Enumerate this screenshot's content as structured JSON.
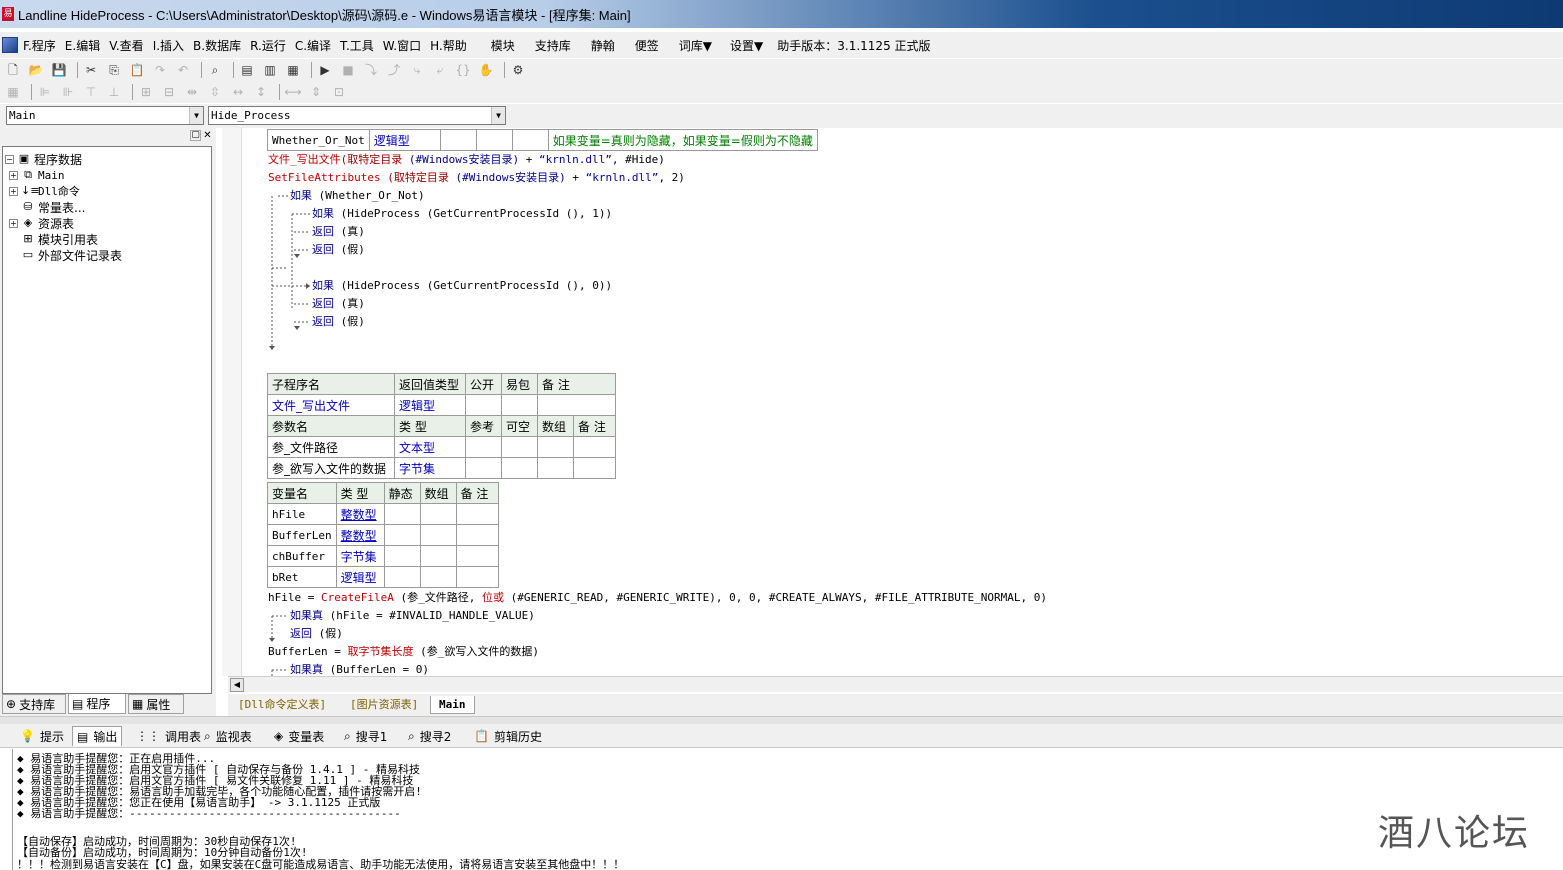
{
  "window": {
    "title": "Landline HideProcess - C:\\Users\\Administrator\\Desktop\\源码\\源码.e - Windows易语言模块 - [程序集: Main]"
  },
  "menu": {
    "items": [
      "F.程序",
      "E.编辑",
      "V.查看",
      "I.插入",
      "B.数据库",
      "R.运行",
      "C.编译",
      "T.工具",
      "W.窗口",
      "H.帮助",
      "模块",
      "支持库",
      "静翰",
      "便签",
      "词库▼",
      "设置▼",
      "助手版本：3.1.1125 正式版"
    ]
  },
  "combos": {
    "left": "Main",
    "right": "Hide_Process"
  },
  "tree": {
    "root": "程序数据",
    "items": [
      "Main",
      "Dll命令",
      "常量表...",
      "资源表",
      "模块引用表",
      "外部文件记录表"
    ]
  },
  "panel_tabs": [
    "支持库",
    "程序",
    "属性"
  ],
  "code": {
    "row_var": {
      "name": "Whether_Or_Not",
      "type": "逻辑型",
      "comment": "如果变量=真则为隐藏，如果变量=假则为不隐藏"
    },
    "l1_fn": "文件_写出文件",
    "l1_a": "(取特定目录",
    "l1_b": " (#Windows安装目录)",
    "l1_c": " + ",
    "l1_d": "“krnln.dll”",
    "l1_e": ", #Hide)",
    "l2_fn": "SetFileAttributes",
    "l2_a": " (取特定目录",
    "l2_b": " (#Windows安装目录)",
    "l2_c": " + ",
    "l2_d": "“krnln.dll”",
    "l2_e": ", 2)",
    "if1": "如果",
    "if1_cond": " (Whether_Or_Not)",
    "if2": "如果",
    "if2_cond": " (HideProcess (GetCurrentProcessId (), 1))",
    "ret_true": "返回",
    "ret_true_v": " (真)",
    "ret_false": "返回",
    "ret_false_v": " (假)",
    "if3": "如果",
    "if3_cond": " (HideProcess (GetCurrentProcessId (), 0))",
    "ret_true2": "返回",
    "ret_true2_v": " (真)",
    "ret_false2": "返回",
    "ret_false2_v": " (假)",
    "sub_header": [
      "子程序名",
      "返回值类型",
      "公开",
      "易包",
      "备 注"
    ],
    "sub_row": [
      "文件_写出文件",
      "逻辑型",
      "",
      "",
      ""
    ],
    "param_header": [
      "参数名",
      "类 型",
      "参考",
      "可空",
      "数组",
      "备 注"
    ],
    "params": [
      [
        "参_文件路径",
        "文本型",
        "",
        "",
        "",
        ""
      ],
      [
        "参_欲写入文件的数据",
        "字节集",
        "",
        "",
        "",
        ""
      ]
    ],
    "var_header": [
      "变量名",
      "类 型",
      "静态",
      "数组",
      "备 注"
    ],
    "vars": [
      [
        "hFile",
        "整数型",
        "",
        "",
        ""
      ],
      [
        "BufferLen",
        "整数型",
        "",
        "",
        ""
      ],
      [
        "chBuffer",
        "字节集",
        "",
        "",
        ""
      ],
      [
        "bRet",
        "逻辑型",
        "",
        "",
        ""
      ]
    ],
    "l3_a": "hFile = ",
    "l3_fn": "CreateFileA",
    "l3_b": " (参_文件路径, ",
    "l3_c": "位或",
    "l3_d": " (#GENERIC_READ, #GENERIC_WRITE), 0, 0, #CREATE_ALWAYS, #FILE_ATTRIBUTE_NORMAL, 0)",
    "l4_kw": "如果真",
    "l4_cond": " (hFile = #INVALID_HANDLE_VALUE)",
    "l5_kw": "返回",
    "l5_v": " (假)",
    "l6_a": "BufferLen = ",
    "l6_fn": "取字节集长度",
    "l6_b": " (参_欲写入文件的数据)",
    "l7_kw": "如果真",
    "l7_cond": " (BufferLen = 0)"
  },
  "doc_tabs": [
    "[Dll命令定义表]",
    "[图片资源表]",
    "Main"
  ],
  "out_tabs": [
    "提示",
    "输出",
    "调用表",
    "监视表",
    "变量表",
    "搜寻1",
    "搜寻2",
    "剪辑历史"
  ],
  "output_lines": [
    "◆ 易语言助手提醒您：正在启用插件...",
    "◆ 易语言助手提醒您：启用文官方插件 [ 自动保存与备份 1.4.1 ] - 精易科技",
    "◆ 易语言助手提醒您：启用文官方插件 [ 易文件关联修复 1.11 ] - 精易科技",
    "◆ 易语言助手提醒您：易语言助手加载完毕，各个功能随心配置，插件请按需开启!",
    "◆ 易语言助手提醒您：您正在使用【易语言助手】 -> 3.1.1125 正式版",
    "◆ 易语言助手提醒您：-----------------------------------------",
    "",
    "【自动保存】启动成功，时间周期为：30秒自动保存1次!",
    "【自动备份】启动成功，时间周期为：10分钟自动备份1次!",
    "！！！检测到易语言安装在【C】盘，如果安装在C盘可能造成易语言、助手功能无法使用，请将易语言安装至其他盘中！！！"
  ],
  "watermark": "酒八论坛"
}
